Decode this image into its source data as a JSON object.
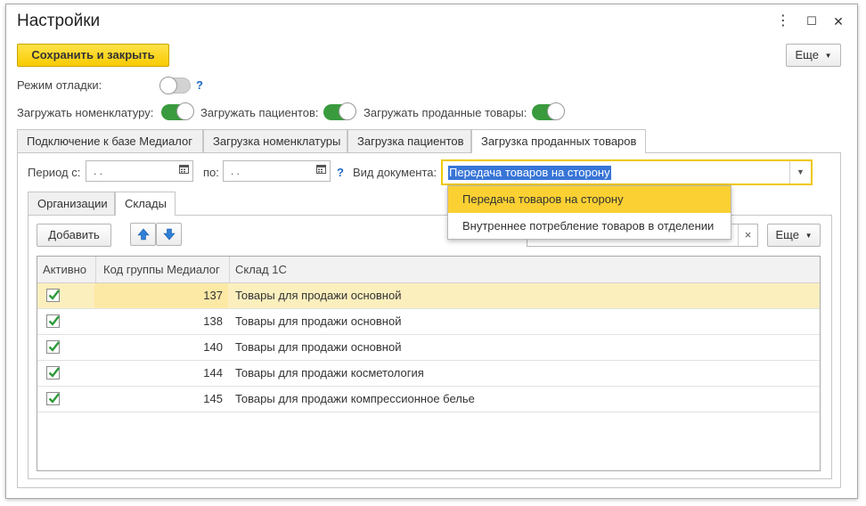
{
  "window": {
    "title": "Настройки",
    "controls": [
      "⋮",
      "☐",
      "✕"
    ]
  },
  "toolbar": {
    "save_close_label": "Сохранить и закрыть",
    "more_label": "Еще"
  },
  "debug": {
    "label": "Режим отладки:",
    "enabled": false,
    "help": "?"
  },
  "toggles": [
    {
      "label": "Загружать номенклатуру:",
      "enabled": true
    },
    {
      "label": "Загружать пациентов:",
      "enabled": true
    },
    {
      "label": "Загружать проданные товары:",
      "enabled": true
    }
  ],
  "tabs": [
    {
      "label": "Подключение к базе Медиалог",
      "active": false
    },
    {
      "label": "Загрузка номенклатуры",
      "active": false
    },
    {
      "label": "Загрузка пациентов",
      "active": false
    },
    {
      "label": "Загрузка проданных товаров",
      "active": true
    }
  ],
  "period": {
    "from_label": "Период с:",
    "from_value": " .  .",
    "to_label": "по:",
    "to_value": " .  .",
    "help": "?"
  },
  "doc_type": {
    "label": "Вид документа:",
    "value": "Передача товаров на сторону",
    "options": [
      {
        "label": "Передача товаров на сторону",
        "selected": true
      },
      {
        "label": "Внутреннее потребление товаров в отделении",
        "selected": false
      }
    ]
  },
  "subtabs": [
    {
      "label": "Организации",
      "active": false
    },
    {
      "label": "Склады",
      "active": true
    }
  ],
  "list_toolbar": {
    "add_label": "Добавить",
    "clear_glyph": "×",
    "more_label": "Еще"
  },
  "table": {
    "columns": [
      "Активно",
      "Код группы Медиалог",
      "Склад 1С"
    ],
    "rows": [
      {
        "active": true,
        "code": "137",
        "warehouse": "Товары для продажи основной",
        "selected": true
      },
      {
        "active": true,
        "code": "138",
        "warehouse": "Товары для продажи основной",
        "selected": false
      },
      {
        "active": true,
        "code": "140",
        "warehouse": "Товары для продажи основной",
        "selected": false
      },
      {
        "active": true,
        "code": "144",
        "warehouse": "Товары для продажи косметология",
        "selected": false
      },
      {
        "active": true,
        "code": "145",
        "warehouse": "Товары для продажи компрессионное белье",
        "selected": false
      }
    ]
  },
  "colors": {
    "accent": "#f8cb00",
    "toggle_on": "#3a9a3e",
    "selection": "#3875d7",
    "row_selected": "#fcefbe"
  }
}
